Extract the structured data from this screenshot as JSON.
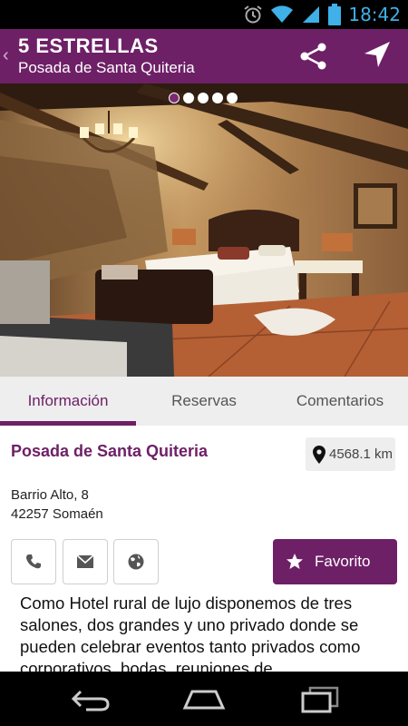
{
  "status_bar": {
    "time": "18:42"
  },
  "action_bar": {
    "title": "5 ESTRELLAS",
    "subtitle": "Posada de Santa Quiteria"
  },
  "gallery": {
    "pages": 5,
    "current": 1
  },
  "tabs": [
    {
      "label": "Información",
      "active": true
    },
    {
      "label": "Reservas",
      "active": false
    },
    {
      "label": "Comentarios",
      "active": false
    }
  ],
  "hotel": {
    "name": "Posada de Santa Quiteria",
    "address_line1": "Barrio Alto, 8",
    "address_line2": "42257 Somaén",
    "distance": "4568.1 km",
    "favorite_label": "Favorito",
    "description": "Como Hotel rural de lujo disponemos de tres salones, dos grandes y uno privado donde se pueden celebrar eventos tanto privados como corporativos, bodas, reuniones de"
  },
  "icons": {
    "phone": "phone-icon",
    "email": "email-icon",
    "web": "globe-icon",
    "favorite": "star-icon",
    "share": "share-icon",
    "navigate": "navigation-arrow-icon"
  },
  "colors": {
    "brand": "#6e2067",
    "tab_bar": "#eeeeee",
    "status_time": "#3fb0e8"
  }
}
